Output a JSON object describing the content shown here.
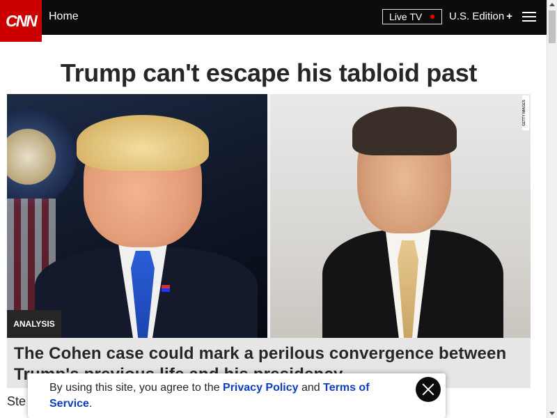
{
  "nav": {
    "logo": "CNN",
    "home": "Home",
    "live_tv": "Live TV",
    "edition": "U.S. Edition",
    "edition_symbol": "+"
  },
  "article": {
    "headline": "Trump can't escape his tabloid past",
    "badge": "ANALYSIS",
    "caption": "The Cohen case could mark a perilous convergence between Trump's previous life and his presidency",
    "photo_credit": "GETTY IMAGES",
    "byline_partial": "Ste"
  },
  "consent": {
    "prefix": "By using this site, you agree to the ",
    "privacy_link": "Privacy Policy",
    "and": " and ",
    "terms_link": "Terms of Service",
    "suffix": "."
  },
  "colors": {
    "brand_red": "#cc0000",
    "nav_bg": "#0c0c0c",
    "live_dot": "#ee0000",
    "link_blue": "#0c3ebe"
  }
}
